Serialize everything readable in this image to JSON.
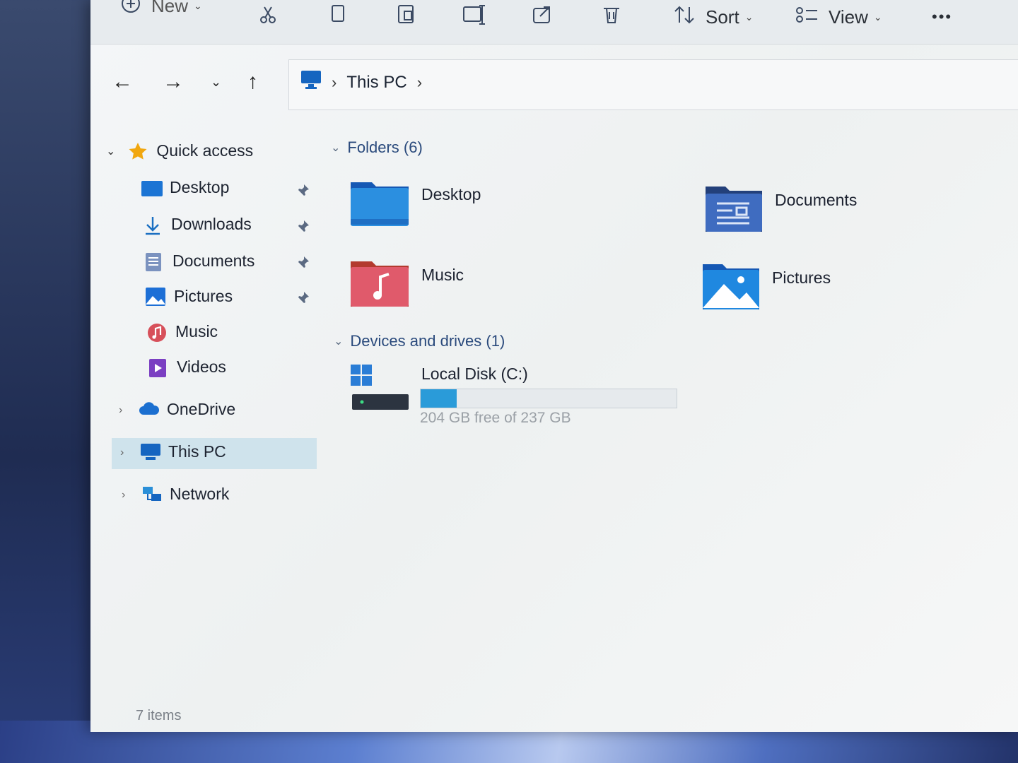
{
  "toolbar": {
    "new_label": "New",
    "sort_label": "Sort",
    "view_label": "View",
    "more_label": "•••"
  },
  "address": {
    "crumbs": [
      "This PC"
    ]
  },
  "sidebar": {
    "quick_access": "Quick access",
    "items": [
      {
        "label": "Desktop",
        "pinned": true
      },
      {
        "label": "Downloads",
        "pinned": true
      },
      {
        "label": "Documents",
        "pinned": true
      },
      {
        "label": "Pictures",
        "pinned": true
      },
      {
        "label": "Music",
        "pinned": false
      },
      {
        "label": "Videos",
        "pinned": false
      }
    ],
    "onedrive": "OneDrive",
    "this_pc": "This PC",
    "network": "Network"
  },
  "main": {
    "folders_header": "Folders (6)",
    "folders": [
      {
        "label": "Desktop"
      },
      {
        "label": "Documents"
      },
      {
        "label": "Music"
      },
      {
        "label": "Pictures"
      }
    ],
    "drives_header": "Devices and drives (1)",
    "drive": {
      "label": "Local Disk (C:)",
      "free_text": "204 GB free of 237 GB",
      "used_fraction": 0.14
    }
  },
  "status": {
    "items": "7 items"
  },
  "colors": {
    "accent": "#2a9bd9",
    "folder_blue": "#1f7fd6",
    "selection": "#cfe3ec"
  }
}
